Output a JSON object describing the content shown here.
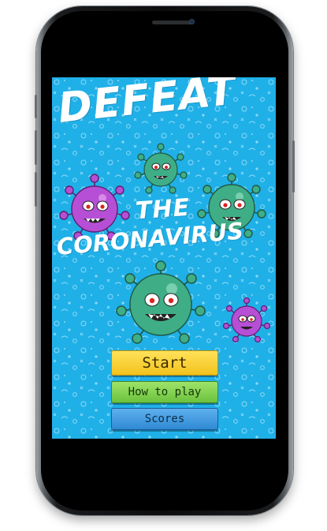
{
  "game": {
    "title_line1": "DEFEAT",
    "title_line2": "THE",
    "title_line3": "CORONAVIRUS"
  },
  "menu": {
    "start_label": "Start",
    "how_to_play_label": "How to play",
    "scores_label": "Scores"
  },
  "colors": {
    "background": "#1fb0e8",
    "virus_purple": "#b64fd6",
    "virus_green": "#3fae87",
    "start_button": "#f2c21c",
    "how_to_play_button": "#6cc23e",
    "scores_button": "#2f8ad4"
  },
  "sprites": [
    "purple-virus",
    "green-virus"
  ]
}
